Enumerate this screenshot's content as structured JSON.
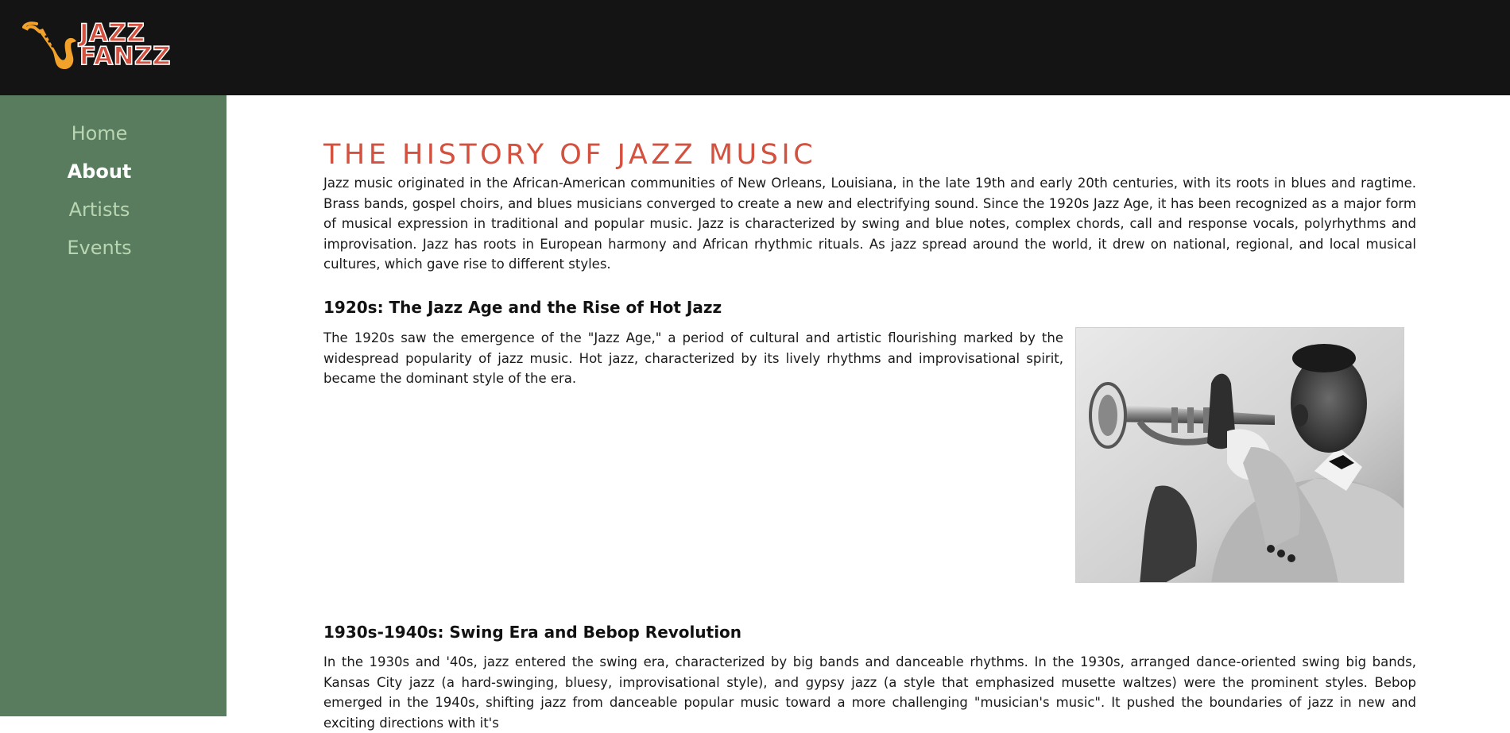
{
  "brand": {
    "logo_line1": "JAZZ",
    "logo_line2": "FANZZ",
    "logo_color": "#d4513f",
    "sax_color": "#f2a22a"
  },
  "colors": {
    "topbar": "#141414",
    "sidebar": "#5a7c5e",
    "nav_inactive": "#b9d6b2",
    "nav_active": "#ffffff",
    "title": "#d4513f"
  },
  "nav": {
    "items": [
      {
        "label": "Home",
        "active": false
      },
      {
        "label": "About",
        "active": true
      },
      {
        "label": "Artists",
        "active": false
      },
      {
        "label": "Events",
        "active": false
      }
    ]
  },
  "main": {
    "title": "THE HISTORY OF JAZZ MUSIC",
    "intro": "Jazz music originated in the African-American communities of New Orleans, Louisiana, in the late 19th and early 20th centuries, with its roots in blues and ragtime. Brass bands, gospel choirs, and blues musicians converged to create a new and electrifying sound. Since the 1920s Jazz Age, it has been recognized as a major form of musical expression in traditional and popular music. Jazz is characterized by swing and blue notes, complex chords, call and response vocals, polyrhythms and improvisation. Jazz has roots in European harmony and African rhythmic rituals. As jazz spread around the world, it drew on national, regional, and local musical cultures, which gave rise to different styles.",
    "sections": [
      {
        "heading": "1920s: The Jazz Age and the Rise of Hot Jazz",
        "text": "The 1920s saw the emergence of the \"Jazz Age,\" a period of cultural and artistic flourishing marked by the widespread popularity of jazz music. Hot jazz, characterized by its lively rhythms and improvisational spirit, became the dominant style of the era."
      },
      {
        "heading": "1930s-1940s: Swing Era and Bebop Revolution",
        "text": "In the 1930s and '40s, jazz entered the swing era, characterized by big bands and danceable rhythms. In the 1930s, arranged dance-oriented swing big bands, Kansas City jazz (a hard-swinging, bluesy, improvisational style), and gypsy jazz (a style that emphasized musette waltzes) were the prominent styles. Bebop emerged in the 1940s, shifting jazz from danceable popular music toward a more challenging \"musician's music\". It pushed the boundaries of jazz in new and exciting directions with it's"
      }
    ]
  }
}
